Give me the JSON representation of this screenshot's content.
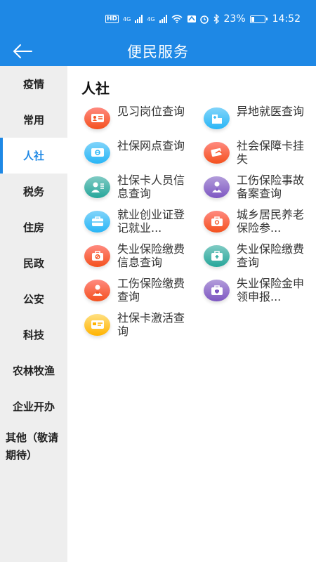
{
  "status_bar": {
    "left_indicators": [
      "HD",
      "4G",
      "4G"
    ],
    "battery_percent": "23%",
    "time": "14:52",
    "battery_level": 0.23
  },
  "header": {
    "title": "便民服务",
    "back_icon": "arrow-left-icon"
  },
  "sidebar": {
    "items": [
      {
        "label": "疫情"
      },
      {
        "label": "常用"
      },
      {
        "label": "人社"
      },
      {
        "label": "税务"
      },
      {
        "label": "住房"
      },
      {
        "label": "民政"
      },
      {
        "label": "公安"
      },
      {
        "label": "科技"
      },
      {
        "label": "农林牧渔"
      },
      {
        "label": "企业开办"
      },
      {
        "label": "其他（敬请期待）"
      }
    ],
    "active_index": 2
  },
  "main": {
    "section_title": "人社",
    "services": [
      {
        "label": "见习岗位查询",
        "icon": "id-card-icon",
        "color": "#f4511e"
      },
      {
        "label": "异地就医查询",
        "icon": "hospital-icon",
        "color": "#29b6f6"
      },
      {
        "label": "社保网点查询",
        "icon": "card-icon",
        "color": "#29b6f6"
      },
      {
        "label": "社会保障卡挂失",
        "icon": "card-report-icon",
        "color": "#f4511e"
      },
      {
        "label": "社保卡人员信息查询",
        "icon": "person-info-icon",
        "color": "#26a69a"
      },
      {
        "label": "工伤保险事故备案查询",
        "icon": "injury-icon",
        "color": "#7e57c2"
      },
      {
        "label": "就业创业证登记就业...",
        "icon": "briefcase-icon",
        "color": "#29b6f6"
      },
      {
        "label": "城乡居民养老保险参...",
        "icon": "pension-icon",
        "color": "#f4511e"
      },
      {
        "label": "失业保险缴费信息查询",
        "icon": "unemployment-icon",
        "color": "#f4511e"
      },
      {
        "label": "失业保险缴费查询",
        "icon": "medical-bag-icon",
        "color": "#26a69a"
      },
      {
        "label": "工伤保险缴费查询",
        "icon": "worker-icon",
        "color": "#f4511e"
      },
      {
        "label": "失业保险金申领申报...",
        "icon": "briefcase-shield-icon",
        "color": "#7e57c2"
      },
      {
        "label": "社保卡激活查询",
        "icon": "activate-card-icon",
        "color": "#ffb300"
      }
    ]
  }
}
